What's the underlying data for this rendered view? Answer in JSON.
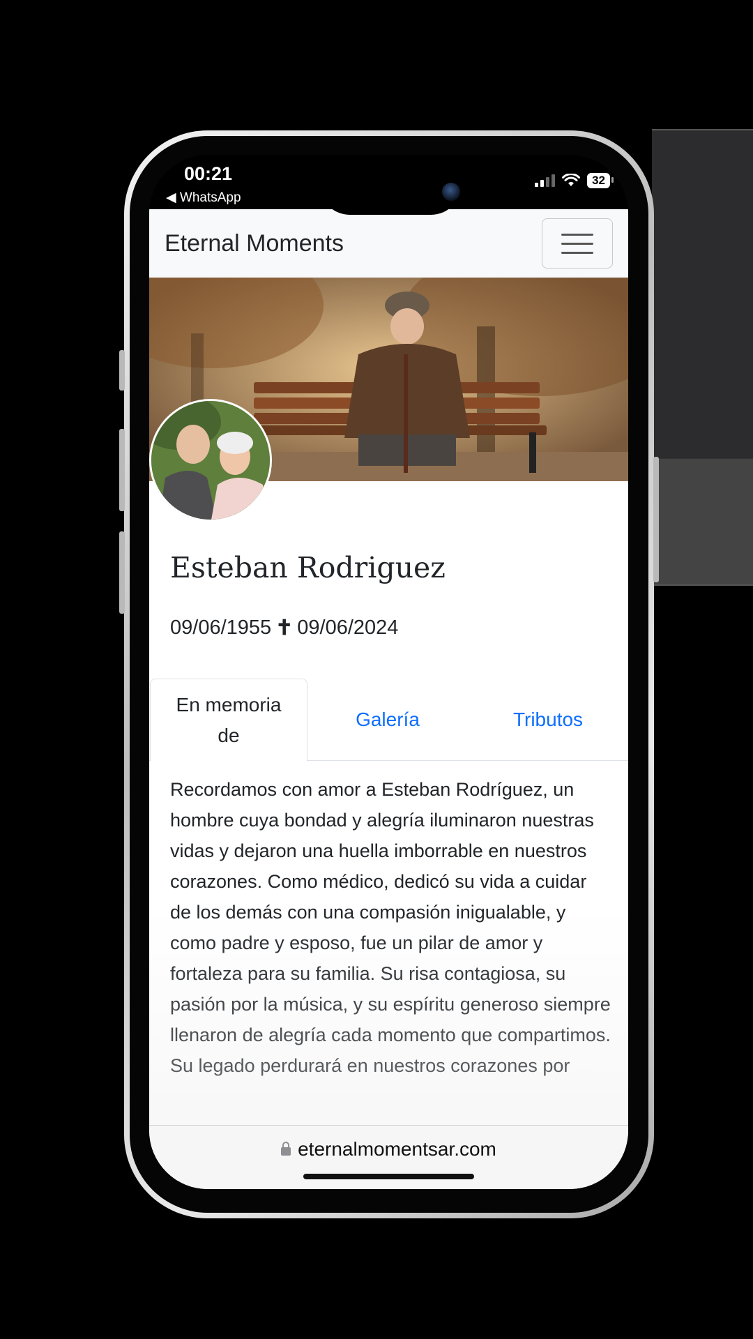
{
  "status_bar": {
    "time": "00:21",
    "back_app": "◀ WhatsApp",
    "battery": "32"
  },
  "navbar": {
    "brand": "Eternal Moments",
    "menu_icon": "hamburger-icon"
  },
  "profile": {
    "name": "Esteban Rodriguez",
    "birth_date": "09/06/1955",
    "death_symbol": "✝",
    "death_date": "09/06/2024"
  },
  "tabs": [
    {
      "label": "En memoria de",
      "active": true
    },
    {
      "label": "Galería",
      "active": false
    },
    {
      "label": "Tributos",
      "active": false
    }
  ],
  "memorial": {
    "text": "Recordamos con amor a Esteban Rodríguez, un hombre cuya bondad y alegría iluminaron nuestras vidas y dejaron una huella imborrable en nuestros corazones. Como médico, dedicó su vida a cuidar de los demás con una compasión inigualable, y como padre y esposo, fue un pilar de amor y fortaleza para su familia. Su risa contagiosa, su pasión por la música, y su espíritu generoso siempre llenaron de alegría cada momento que compartimos. Su legado perdurará en nuestros corazones por"
  },
  "browser": {
    "url": "eternalmomentsar.com"
  },
  "colors": {
    "link": "#0d6efd",
    "navbar_bg": "#f8f9fa",
    "text": "#212529"
  }
}
